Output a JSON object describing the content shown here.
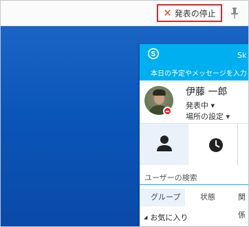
{
  "toolbar": {
    "stop_label": "発表の停止",
    "stop_icon": "close-x-icon",
    "pin_icon": "pin-icon",
    "accent": "#d7262c"
  },
  "skype": {
    "title_partial": "Sk",
    "mood_placeholder": "本日の予定やメッセージを入力",
    "brand_color": "#00aff0",
    "profile": {
      "name": "伊藤 一郎",
      "status": "発表中 ▾",
      "location": "場所の設定 ▾"
    },
    "search_placeholder": "ユーザーの検索",
    "tabs": [
      "グループ",
      "状態",
      "関係"
    ],
    "group": "お気に入り"
  }
}
